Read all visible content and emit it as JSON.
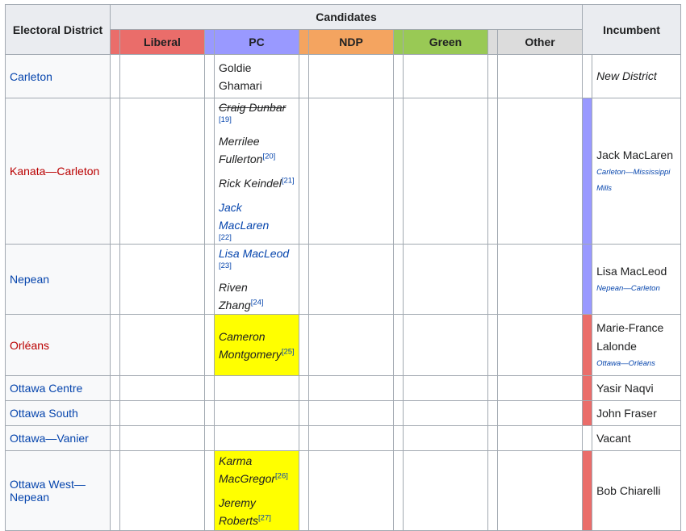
{
  "headers": {
    "district": "Electoral District",
    "candidates": "Candidates",
    "incumbent": "Incumbent"
  },
  "parties": [
    {
      "name": "Liberal",
      "color": "#EA6D6A"
    },
    {
      "name": "PC",
      "color": "#9999FF"
    },
    {
      "name": "NDP",
      "color": "#F4A460"
    },
    {
      "name": "Green",
      "color": "#99C955"
    },
    {
      "name": "Other",
      "color": "#DCDCDC"
    }
  ],
  "winner_highlight": "#FFFF00",
  "rows": [
    {
      "district": "Carleton",
      "district_color": "#0645AD",
      "pc": [
        {
          "name": "Goldie Ghamari",
          "style": "plain"
        }
      ],
      "pc_winner": false,
      "incumbent": {
        "name": "New District",
        "style": "italic",
        "note": "",
        "party_color": "#FFFFFF"
      }
    },
    {
      "district": "Kanata—Carleton",
      "district_color": "#BA0000",
      "pc": [
        {
          "name": "Craig Dunbar",
          "style": "strike",
          "ref": "[19]"
        },
        {
          "name": "Merrilee Fullerton",
          "style": "italic",
          "ref": "[20]"
        },
        {
          "name": "Rick Keindel",
          "style": "italic",
          "ref": "[21]"
        },
        {
          "name": "Jack MacLaren",
          "style": "link",
          "ref": "[22]"
        }
      ],
      "pc_winner": false,
      "incumbent": {
        "name": "Jack MacLaren",
        "style": "plain",
        "note": "Carleton—Mississippi Mills",
        "party_color": "#9999FF"
      }
    },
    {
      "district": "Nepean",
      "district_color": "#0645AD",
      "pc": [
        {
          "name": "Lisa MacLeod",
          "style": "link",
          "ref": "[23]"
        },
        {
          "name": "Riven Zhang",
          "style": "italic",
          "ref": "[24]"
        }
      ],
      "pc_winner": false,
      "incumbent": {
        "name": "Lisa MacLeod",
        "style": "plain",
        "note": "Nepean—Carleton",
        "party_color": "#9999FF"
      }
    },
    {
      "district": "Orléans",
      "district_color": "#BA0000",
      "pc": [
        {
          "name": "Cameron Montgomery",
          "style": "italic",
          "ref": "[25]"
        }
      ],
      "pc_winner": true,
      "incumbent": {
        "name": "Marie-France Lalonde",
        "style": "plain",
        "note": "Ottawa—Orléans",
        "party_color": "#EA6D6A"
      }
    },
    {
      "district": "Ottawa Centre",
      "district_color": "#0645AD",
      "pc": [],
      "pc_winner": false,
      "incumbent": {
        "name": "Yasir Naqvi",
        "style": "plain",
        "note": "",
        "party_color": "#EA6D6A"
      }
    },
    {
      "district": "Ottawa South",
      "district_color": "#0645AD",
      "pc": [],
      "pc_winner": false,
      "incumbent": {
        "name": "John Fraser",
        "style": "plain",
        "note": "",
        "party_color": "#EA6D6A"
      }
    },
    {
      "district": "Ottawa—Vanier",
      "district_color": "#0645AD",
      "pc": [],
      "pc_winner": false,
      "incumbent": {
        "name": "Vacant",
        "style": "plain",
        "note": "",
        "party_color": "#FFFFFF"
      }
    },
    {
      "district": "Ottawa West—Nepean",
      "district_color": "#0645AD",
      "pc": [
        {
          "name": "Karma MacGregor",
          "style": "italic",
          "ref": "[26]"
        },
        {
          "name": "Jeremy Roberts",
          "style": "italic",
          "ref": "[27]"
        }
      ],
      "pc_winner": true,
      "incumbent": {
        "name": "Bob Chiarelli",
        "style": "plain",
        "note": "",
        "party_color": "#EA6D6A"
      }
    }
  ]
}
